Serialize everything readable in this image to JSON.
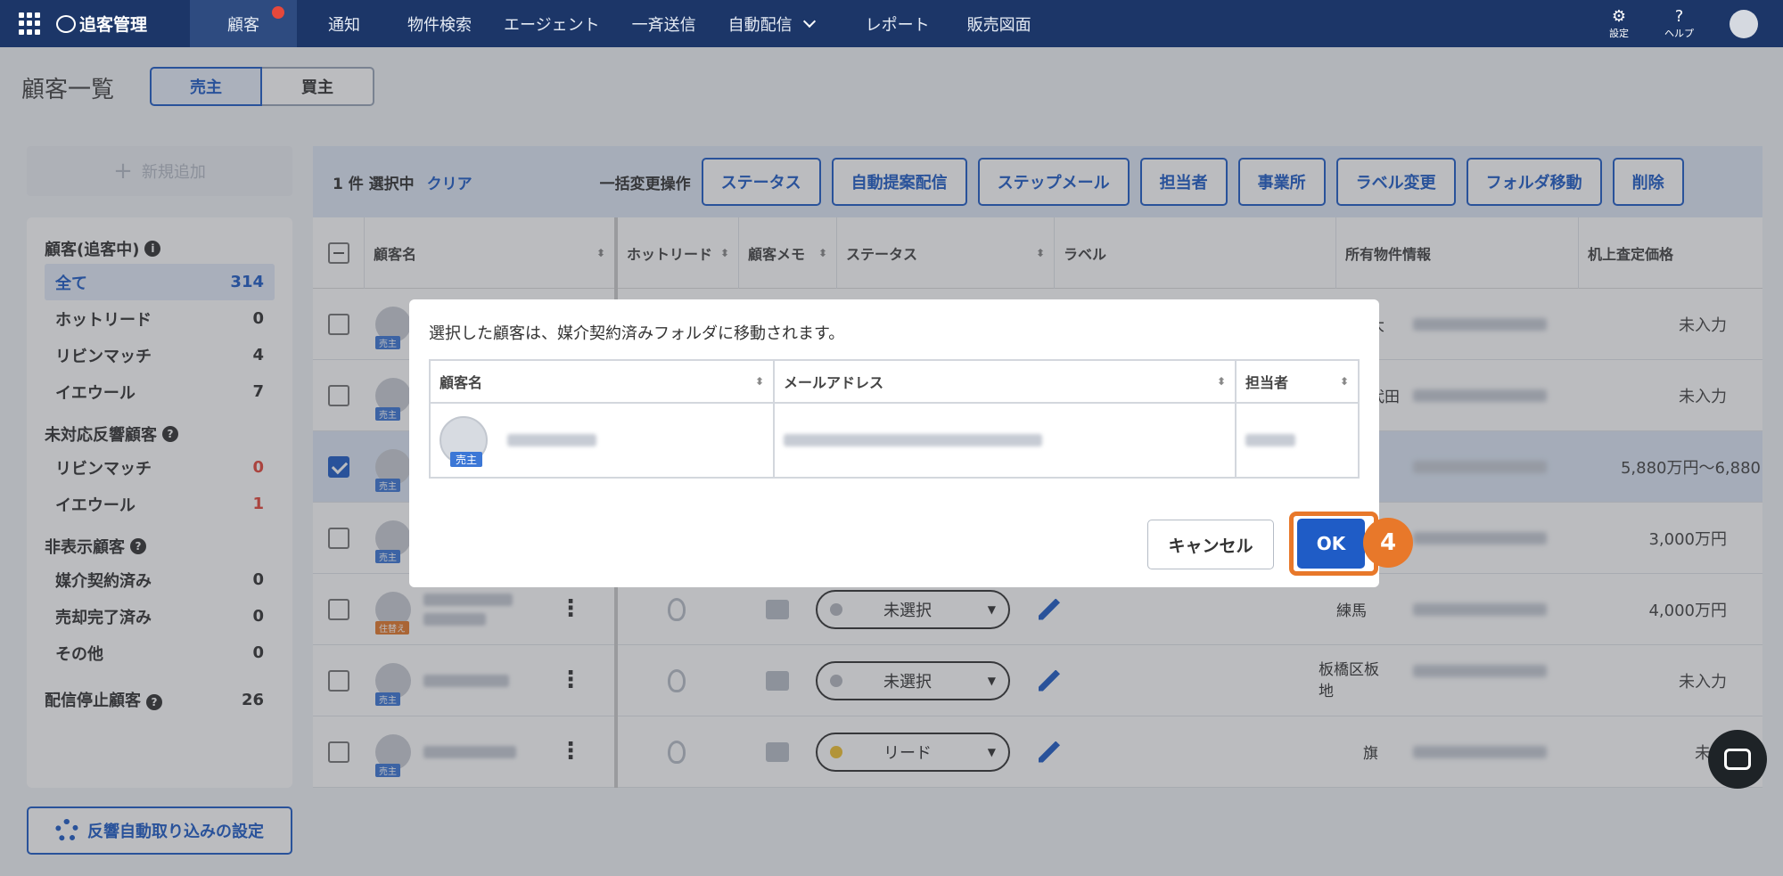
{
  "nav": {
    "brand": "追客管理",
    "items": [
      "顧客",
      "通知",
      "物件検索",
      "エージェント",
      "一斉送信",
      "自動配信",
      "レポート",
      "販売図面"
    ],
    "settings_label": "設定",
    "help_label": "ヘルプ"
  },
  "page": {
    "title": "顧客一覧",
    "seg_seller": "売主",
    "seg_buyer": "買主"
  },
  "side": {
    "add_button": "新規追加",
    "group1_title": "顧客(追客中)",
    "group1": [
      {
        "label": "全て",
        "count": "314"
      },
      {
        "label": "ホットリード",
        "count": "0"
      },
      {
        "label": "リビンマッチ",
        "count": "4"
      },
      {
        "label": "イエウール",
        "count": "7"
      }
    ],
    "group2_title": "未対応反響顧客",
    "group2": [
      {
        "label": "リビンマッチ",
        "count": "0"
      },
      {
        "label": "イエウール",
        "count": "1"
      }
    ],
    "group3_title": "非表示顧客",
    "group3": [
      {
        "label": "媒介契約済み",
        "count": "0"
      },
      {
        "label": "売却完了済み",
        "count": "0"
      },
      {
        "label": "その他",
        "count": "0"
      }
    ],
    "stopped_label": "配信停止顧客",
    "stopped_count": "26",
    "auto_import_button": "反響自動取り込みの設定"
  },
  "bulk": {
    "selected": "1 件 選択中",
    "clear": "クリア",
    "label": "一括変更操作",
    "buttons": [
      "ステータス",
      "自動提案配信",
      "ステップメール",
      "担当者",
      "事業所",
      "ラベル変更",
      "フォルダ移動",
      "削除"
    ]
  },
  "table": {
    "headers": [
      "顧客名",
      "ホットリード",
      "顧客メモ",
      "ステータス",
      "ラベル",
      "所有物件情報",
      "机上査定価格"
    ],
    "rows": [
      {
        "tag": "売主",
        "prop": "市大",
        "price": "未入力"
      },
      {
        "tag": "売主",
        "prop": "千代田",
        "price": "未入力"
      },
      {
        "tag": "売主",
        "prop": "",
        "price": "5,880万円〜6,880"
      },
      {
        "tag": "売主",
        "prop": "",
        "price": "3,000万円"
      },
      {
        "tag": "住替え",
        "status": "未選択",
        "prop": "練馬",
        "price": "4,000万円"
      },
      {
        "tag": "売主",
        "status": "未選択",
        "prop": "板橋区板 地",
        "price": "未入力"
      },
      {
        "tag": "売主",
        "status": "リード",
        "prop": "旗",
        "price": "未入"
      }
    ]
  },
  "modal": {
    "message": "選択した顧客は、媒介契約済みフォルダに移動されます。",
    "headers": [
      "顧客名",
      "メールアドレス",
      "担当者"
    ],
    "row_tag": "売主",
    "cancel": "キャンセル",
    "ok": "OK",
    "step_number": "4"
  },
  "colors": {
    "nav_bg": "#1c3668",
    "accent": "#1f5cc6",
    "highlight": "#e8782a",
    "alert": "#e5483b"
  }
}
